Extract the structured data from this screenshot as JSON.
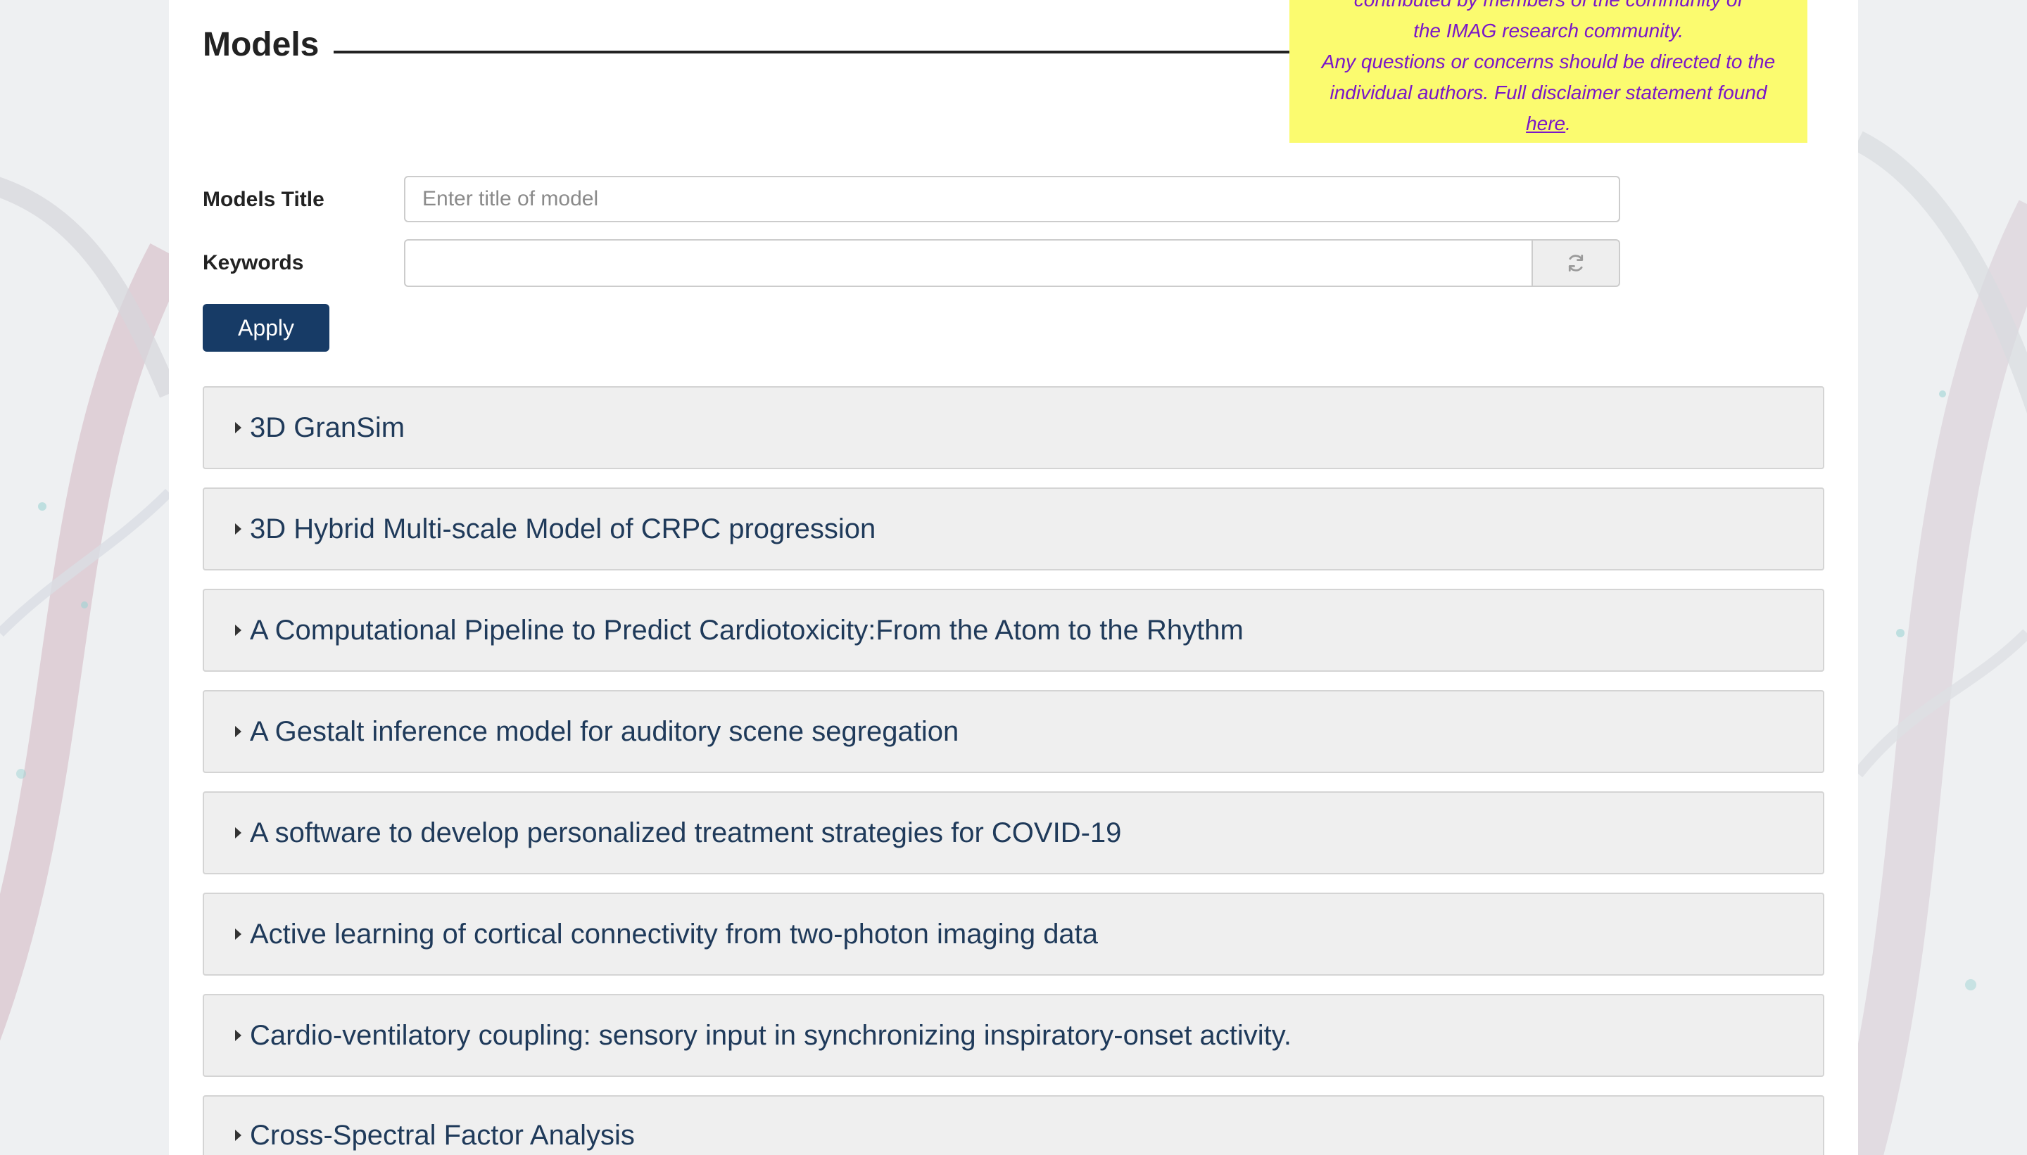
{
  "section": {
    "title": "Models"
  },
  "disclaimer": {
    "line_top": "contributed by members of the community of",
    "line_1": "the IMAG research community.",
    "line_2": "Any questions or concerns should be directed to the",
    "line_3": "individual authors. Full disclaimer statement found",
    "link_text": "here",
    "link_suffix": "."
  },
  "filters": {
    "title_label": "Models Title",
    "title_placeholder": "Enter title of model",
    "title_value": "",
    "keywords_label": "Keywords",
    "keywords_value": "",
    "refresh_icon": "refresh-icon",
    "apply_label": "Apply"
  },
  "models": [
    {
      "title": "3D GranSim"
    },
    {
      "title": "3D Hybrid Multi-scale Model of CRPC progression"
    },
    {
      "title": "A Computational Pipeline to Predict Cardiotoxicity:From the Atom to the Rhythm"
    },
    {
      "title": "A Gestalt inference model for auditory scene segregation"
    },
    {
      "title": "A software to develop personalized treatment strategies for COVID-19"
    },
    {
      "title": "Active learning of cortical connectivity from two-photon imaging data"
    },
    {
      "title": "Cardio-ventilatory coupling: sensory input in synchronizing inspiratory-onset activity."
    },
    {
      "title": "Cross-Spectral Factor Analysis"
    }
  ],
  "colors": {
    "apply_button": "#173b66",
    "disclaimer_bg": "#fbfb6f",
    "disclaimer_text": "#7a16c8",
    "accordion_text": "#1f3a5a"
  }
}
